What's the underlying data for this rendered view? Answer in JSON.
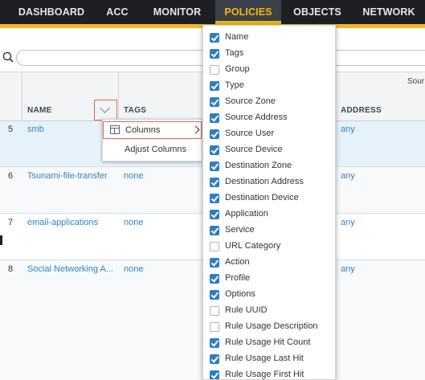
{
  "nav": {
    "items": [
      {
        "label": "DASHBOARD"
      },
      {
        "label": "ACC"
      },
      {
        "label": "MONITOR"
      },
      {
        "label": "POLICIES"
      },
      {
        "label": "OBJECTS"
      },
      {
        "label": "NETWORK"
      }
    ],
    "active": "POLICIES"
  },
  "search": {
    "placeholder": ""
  },
  "grid": {
    "group_header": "Sour",
    "columns": {
      "name": "NAME",
      "tags": "TAGS",
      "address": "ADDRESS"
    },
    "rows": [
      {
        "num": "5",
        "name": "smb",
        "tags": "",
        "address": "any",
        "selected": true
      },
      {
        "num": "6",
        "name": "Tsunami-file-transfer",
        "tags": "none",
        "address": "any"
      },
      {
        "num": "7",
        "name": "email-applications",
        "tags": "none",
        "address": "any"
      },
      {
        "num": "8",
        "name": "Social Networking A...",
        "tags": "none",
        "address": "any"
      }
    ]
  },
  "context_menu": {
    "columns_label": "Columns",
    "adjust_label": "Adjust Columns"
  },
  "column_chooser": {
    "options": [
      {
        "label": "Name",
        "checked": true
      },
      {
        "label": "Tags",
        "checked": true
      },
      {
        "label": "Group",
        "checked": false
      },
      {
        "label": "Type",
        "checked": true
      },
      {
        "label": "Source Zone",
        "checked": true
      },
      {
        "label": "Source Address",
        "checked": true
      },
      {
        "label": "Source User",
        "checked": true
      },
      {
        "label": "Source Device",
        "checked": true
      },
      {
        "label": "Destination Zone",
        "checked": true
      },
      {
        "label": "Destination Address",
        "checked": true
      },
      {
        "label": "Destination Device",
        "checked": true
      },
      {
        "label": "Application",
        "checked": true
      },
      {
        "label": "Service",
        "checked": true
      },
      {
        "label": "URL Category",
        "checked": false
      },
      {
        "label": "Action",
        "checked": true
      },
      {
        "label": "Profile",
        "checked": true
      },
      {
        "label": "Options",
        "checked": true
      },
      {
        "label": "Rule UUID",
        "checked": false
      },
      {
        "label": "Rule Usage Description",
        "checked": false
      },
      {
        "label": "Rule Usage Hit Count",
        "checked": true
      },
      {
        "label": "Rule Usage Last Hit",
        "checked": true
      },
      {
        "label": "Rule Usage First Hit",
        "checked": true
      }
    ]
  },
  "colors": {
    "accent": "#f2b823",
    "link": "#2f86c9",
    "checkbox": "#2a7ec8",
    "nav_bg": "#1d1f24"
  }
}
